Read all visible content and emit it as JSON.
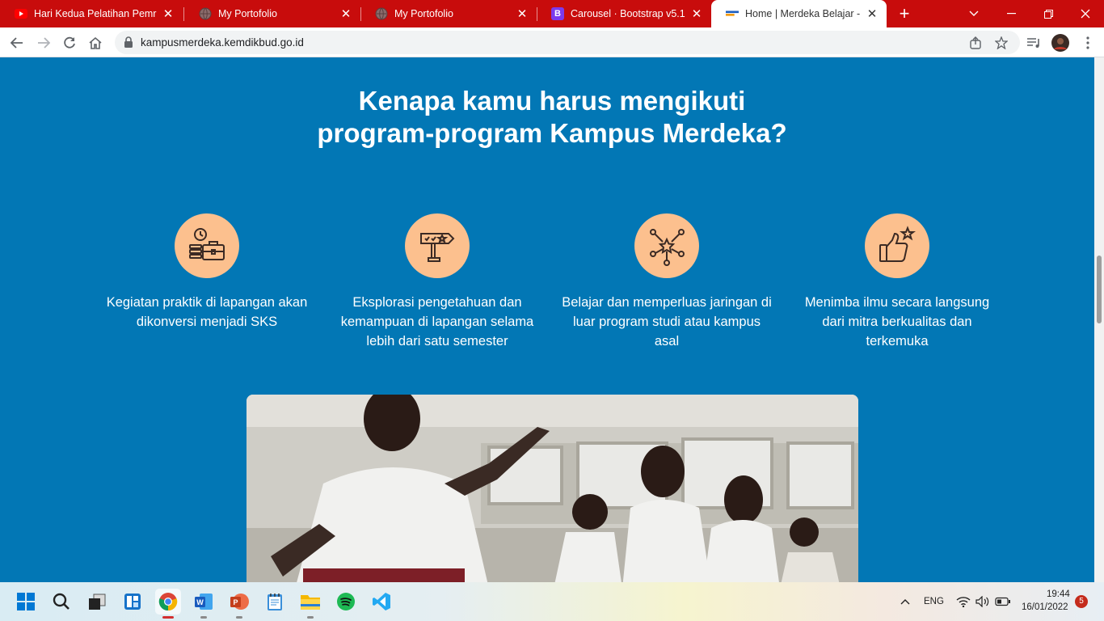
{
  "browser": {
    "tabs": [
      {
        "title": "Hari Kedua Pelatihan Pemrog",
        "favicon": "youtube-icon"
      },
      {
        "title": "My Portofolio",
        "favicon": "globe-icon"
      },
      {
        "title": "My Portofolio",
        "favicon": "globe-icon"
      },
      {
        "title": "Carousel · Bootstrap v5.1",
        "favicon": "bootstrap-icon"
      },
      {
        "title": "Home | Merdeka Belajar - Ka",
        "favicon": "kampus-merdeka-icon",
        "active": true
      }
    ],
    "url": "kampusmerdeka.kemdikbud.go.id"
  },
  "page": {
    "headline_line1": "Kenapa kamu harus mengikuti",
    "headline_line2": "program-program Kampus Merdeka?",
    "features": [
      {
        "icon": "briefcase-clock-icon",
        "text": "Kegiatan praktik di lapangan akan dikonversi menjadi SKS"
      },
      {
        "icon": "signpost-icon",
        "text": "Eksplorasi pengetahuan dan kemampuan di lapangan selama lebih dari satu semester"
      },
      {
        "icon": "network-star-icon",
        "text": "Belajar dan memperluas jaringan di luar program studi atau kampus asal"
      },
      {
        "icon": "thumbs-up-star-icon",
        "text": "Menimba ilmu secara langsung dari mitra berkualitas dan terkemuka"
      }
    ]
  },
  "taskbar": {
    "apps": [
      "windows-start-icon",
      "search-icon",
      "task-view-icon",
      "widgets-icon",
      "chrome-icon",
      "word-icon",
      "powerpoint-icon",
      "notepad-icon",
      "file-explorer-icon",
      "spotify-icon",
      "vscode-icon"
    ],
    "language": "ENG",
    "time": "19:44",
    "date": "16/01/2022",
    "notifications": "5"
  },
  "colors": {
    "page_bg": "#0277b5",
    "tab_strip": "#c80c0c",
    "icon_circle": "#fcc08e"
  }
}
